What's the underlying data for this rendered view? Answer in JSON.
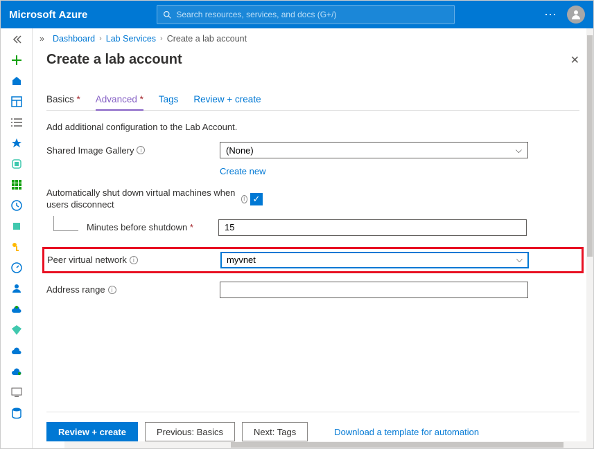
{
  "header": {
    "brand_a": "Microsoft ",
    "brand_b": "Azure",
    "search_placeholder": "Search resources, services, and docs (G+/)"
  },
  "breadcrumb": {
    "dashboard": "Dashboard",
    "lab_services": "Lab Services",
    "current": "Create a lab account"
  },
  "page": {
    "title": "Create a lab account"
  },
  "tabs": {
    "basics": "Basics",
    "advanced": "Advanced",
    "tags": "Tags",
    "review": "Review + create"
  },
  "content": {
    "description": "Add additional configuration to the Lab Account.",
    "shared_gallery_label": "Shared Image Gallery",
    "shared_gallery_value": "(None)",
    "create_new": "Create new",
    "auto_shutdown_label": "Automatically shut down virtual machines when users disconnect",
    "minutes_label": "Minutes before shutdown",
    "minutes_value": "15",
    "peer_vnet_label": "Peer virtual network",
    "peer_vnet_value": "myvnet",
    "address_range_label": "Address range",
    "address_range_value": ""
  },
  "footer": {
    "review": "Review + create",
    "previous": "Previous: Basics",
    "next": "Next: Tags",
    "download": "Download a template for automation"
  }
}
